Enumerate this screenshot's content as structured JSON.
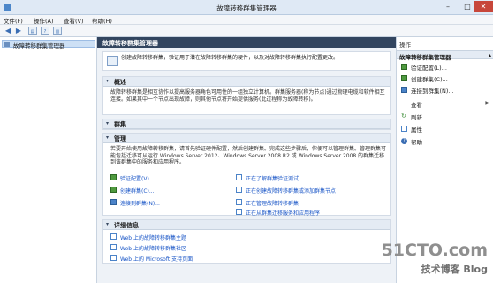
{
  "window": {
    "title": "故障转移群集管理器"
  },
  "menu": [
    "文件(F)",
    "操作(A)",
    "查看(V)",
    "帮助(H)"
  ],
  "tree": {
    "root": "故障转移群集管理器"
  },
  "main": {
    "header": "故障转移群集管理器",
    "intro": "创建故障转移群集，验证用于潜在故障转移群集的硬件，以及对故障转移群集执行配置更改。",
    "overview": {
      "title": "概述",
      "text": "故障转移群集是相互协作以提高服务器角色可用性的一组独立计算机。群集服务器(称为节点)通过物理电缆和软件相互连接。如果其中一个节点出现故障，则其他节点将开始提供服务(此过程称为故障转移)。"
    },
    "clusters": {
      "title": "群集"
    },
    "management": {
      "title": "管理",
      "text": "若要开始使用故障转移群集，请首先验证硬件配置，然后创建群集。完成这些步骤后，你便可以管理群集。管理群集可能包括迁移可从运行 Windows Server 2012、Windows Server 2008 R2 或 Windows Server 2008 的群集迁移到该群集中的服务和应用程序。",
      "left_links": [
        "验证配置(V)...",
        "创建群集(C)...",
        "连接到群集(N)..."
      ],
      "right_links": [
        "正在了解群集验证测试",
        "正在创建故障转移群集或添加群集节点",
        "正在管理故障转移群集",
        "正在从群集迁移服务和应用程序"
      ]
    },
    "more_info": {
      "title": "详细信息",
      "links": [
        "Web 上的故障转移群集主题",
        "Web 上的故障转移群集社区",
        "Web 上的 Microsoft 支持页面"
      ]
    }
  },
  "actions": {
    "header": "操作",
    "group": "故障转移群集管理器",
    "items": [
      {
        "label": "验证配置(L)...",
        "icon": "validate-icon",
        "chevron": ""
      },
      {
        "label": "创建群集(C)...",
        "icon": "create-cluster-icon",
        "chevron": ""
      },
      {
        "label": "连接到群集(N)...",
        "icon": "connect-icon",
        "chevron": ""
      },
      {
        "label": "查看",
        "icon": "",
        "chevron": "▶"
      },
      {
        "label": "刷新",
        "icon": "refresh-icon",
        "chevron": ""
      },
      {
        "label": "属性",
        "icon": "properties-icon",
        "chevron": ""
      },
      {
        "label": "帮助",
        "icon": "help-icon",
        "chevron": ""
      }
    ]
  },
  "watermark": {
    "main": "51CTO.com",
    "sub": "技术博客  Blog"
  },
  "colors": {
    "header": "#32455f",
    "link": "#1a56c7",
    "accent": "#4b83c8"
  }
}
